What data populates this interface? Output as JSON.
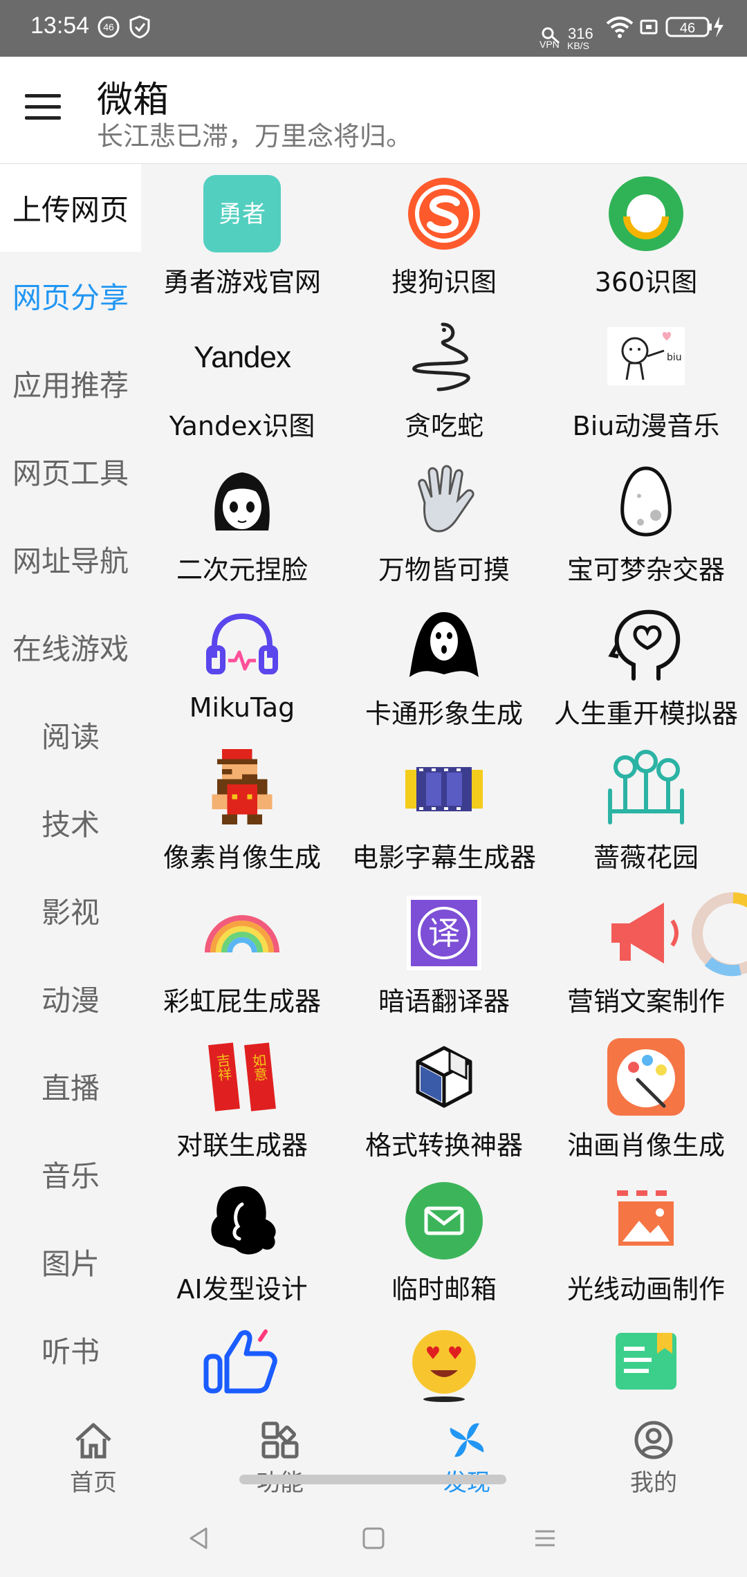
{
  "status_bar": {
    "time": "13:54",
    "net_speed_value": "316",
    "net_speed_unit": "KB/S",
    "battery": "46",
    "vpn": "VPN",
    "badge": "46"
  },
  "header": {
    "title": "微箱",
    "subtitle": "长江悲已滞，万里念将归。"
  },
  "sidebar": {
    "items": [
      "上传网页",
      "网页分享",
      "应用推荐",
      "网页工具",
      "网址导航",
      "在线游戏",
      "阅读",
      "技术",
      "影视",
      "动漫",
      "直播",
      "音乐",
      "图片",
      "听书"
    ]
  },
  "grid": {
    "items": [
      {
        "label": "勇者游戏官网",
        "icon": "yongzhe-icon",
        "icon_text": "勇者"
      },
      {
        "label": "搜狗识图",
        "icon": "sogou-icon"
      },
      {
        "label": "360识图",
        "icon": "360-icon"
      },
      {
        "label": "Yandex识图",
        "icon": "yandex-icon",
        "icon_text": "Yandex"
      },
      {
        "label": "贪吃蛇",
        "icon": "snake-icon"
      },
      {
        "label": "Biu动漫音乐",
        "icon": "biu-icon",
        "icon_text": "biu"
      },
      {
        "label": "二次元捏脸",
        "icon": "anime-face-icon"
      },
      {
        "label": "万物皆可摸",
        "icon": "hand-icon"
      },
      {
        "label": "宝可梦杂交器",
        "icon": "egg-icon"
      },
      {
        "label": "MikuTag",
        "icon": "headphones-icon"
      },
      {
        "label": "卡通形象生成",
        "icon": "ghost-icon"
      },
      {
        "label": "人生重开模拟器",
        "icon": "head-heart-icon"
      },
      {
        "label": "像素肖像生成",
        "icon": "pixel-mario-icon"
      },
      {
        "label": "电影字幕生成器",
        "icon": "film-icon"
      },
      {
        "label": "蔷薇花园",
        "icon": "garden-icon"
      },
      {
        "label": "彩虹屁生成器",
        "icon": "rainbow-icon"
      },
      {
        "label": "暗语翻译器",
        "icon": "translate-icon",
        "icon_text": "译"
      },
      {
        "label": "营销文案制作",
        "icon": "megaphone-icon"
      },
      {
        "label": "对联生成器",
        "icon": "couplet-icon",
        "icon_text_left": "吉祥",
        "icon_text_right": "如意"
      },
      {
        "label": "格式转换神器",
        "icon": "cube-icon"
      },
      {
        "label": "油画肖像生成",
        "icon": "palette-icon"
      },
      {
        "label": "AI发型设计",
        "icon": "hair-icon"
      },
      {
        "label": "临时邮箱",
        "icon": "mail-icon"
      },
      {
        "label": "光线动画制作",
        "icon": "image-icon"
      },
      {
        "label": "",
        "icon": "thumbs-up-icon"
      },
      {
        "label": "",
        "icon": "emoji-icon"
      },
      {
        "label": "",
        "icon": "book-icon"
      }
    ]
  },
  "bottom_nav": {
    "items": [
      {
        "label": "首页",
        "icon": "home-icon"
      },
      {
        "label": "功能",
        "icon": "grid-icon"
      },
      {
        "label": "发现",
        "icon": "pinwheel-icon",
        "active": true
      },
      {
        "label": "我的",
        "icon": "profile-icon"
      }
    ]
  },
  "colors": {
    "accent": "#2196f3",
    "active_blue": "#2196f3"
  }
}
